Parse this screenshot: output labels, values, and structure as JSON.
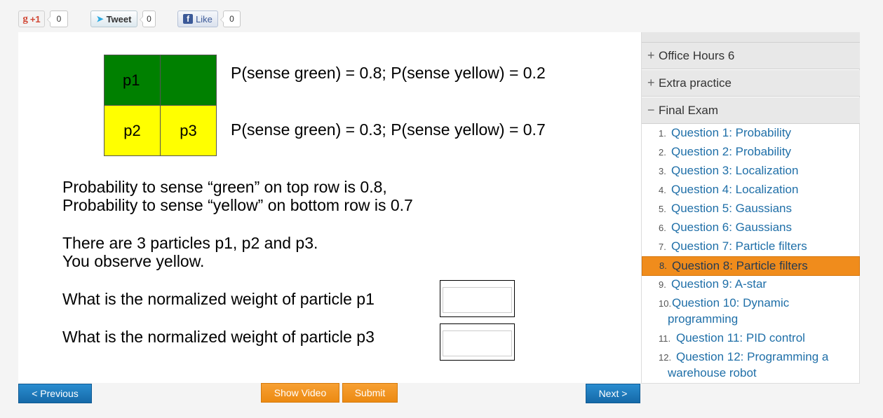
{
  "social": {
    "gplus_label": "+1",
    "gplus_count": "0",
    "tweet_label": "Tweet",
    "tweet_count": "0",
    "like_label": "Like",
    "like_count": "0"
  },
  "quiz": {
    "grid": {
      "top_left": "p1",
      "top_right": "",
      "bottom_left": "p2",
      "bottom_right": "p3",
      "top_color": "#008000",
      "bottom_color": "#ffff00"
    },
    "top_row_prob": "P(sense green) = 0.8; P(sense yellow) = 0.2",
    "bottom_row_prob": "P(sense green) = 0.3; P(sense yellow) = 0.7",
    "para1_line1": "Probability to sense “green” on top row is 0.8,",
    "para1_line2": "Probability to sense “yellow” on bottom row is 0.7",
    "para2_line1": "There are 3 particles p1, p2 and p3.",
    "para2_line2": "You observe yellow.",
    "question_p1": "What is the normalized weight of particle p1",
    "question_p3": "What is the normalized weight of particle p3",
    "answer_p1": "",
    "answer_p3": ""
  },
  "buttons": {
    "previous": "< Previous",
    "show_video": "Show Video",
    "submit": "Submit",
    "next": "Next >"
  },
  "sidebar": {
    "sections": [
      {
        "sign": "+",
        "label": "Office Hours 6"
      },
      {
        "sign": "+",
        "label": "Extra practice"
      },
      {
        "sign": "−",
        "label": "Final Exam"
      }
    ],
    "questions": [
      {
        "num": "1.",
        "label": "Question 1: Probability"
      },
      {
        "num": "2.",
        "label": "Question 2: Probability"
      },
      {
        "num": "3.",
        "label": "Question 3: Localization"
      },
      {
        "num": "4.",
        "label": "Question 4: Localization"
      },
      {
        "num": "5.",
        "label": "Question 5: Gaussians"
      },
      {
        "num": "6.",
        "label": "Question 6: Gaussians"
      },
      {
        "num": "7.",
        "label": "Question 7: Particle filters"
      },
      {
        "num": "8.",
        "label": "Question 8: Particle filters"
      },
      {
        "num": "9.",
        "label": "Question 9: A-star"
      },
      {
        "num": "10.",
        "label": "Question 10: Dynamic programming"
      },
      {
        "num": "11.",
        "label": "Question 11: PID control"
      },
      {
        "num": "12.",
        "label": "Question 12: Programming a warehouse robot"
      }
    ],
    "active_index": 7,
    "link_color": "#1f6fa8",
    "active_color": "#f08c1c"
  }
}
